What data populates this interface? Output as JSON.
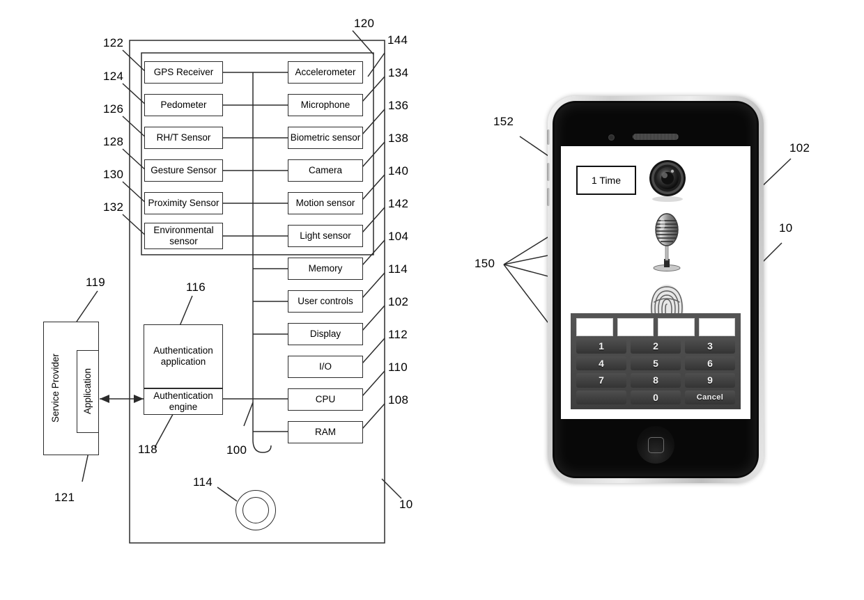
{
  "figure": {
    "left_block_diagram": {
      "device_ref": "10",
      "bus_ref": "100",
      "sensor_group_ref": "120",
      "sensor_group_outer_ref": "144",
      "home_button_ref": "114",
      "sensors_left": [
        {
          "label": "GPS Receiver",
          "ref": "122"
        },
        {
          "label": "Pedometer",
          "ref": "124"
        },
        {
          "label": "RH/T Sensor",
          "ref": "126"
        },
        {
          "label": "Gesture Sensor",
          "ref": "128"
        },
        {
          "label": "Proximity Sensor",
          "ref": "130"
        },
        {
          "label": "Environmental sensor",
          "ref": "132"
        }
      ],
      "sensors_right": [
        {
          "label": "Accelerometer",
          "ref": "134"
        },
        {
          "label": "Microphone",
          "ref": "136"
        },
        {
          "label": "Biometric sensor",
          "ref": "138"
        },
        {
          "label": "Camera",
          "ref": "140"
        },
        {
          "label": "Motion sensor",
          "ref": "142"
        },
        {
          "label": "Light sensor",
          "ref": "104"
        }
      ],
      "components": [
        {
          "label": "Memory",
          "ref": "114"
        },
        {
          "label": "User controls",
          "ref": "102"
        },
        {
          "label": "Display",
          "ref": "112"
        },
        {
          "label": "I/O",
          "ref": "110"
        },
        {
          "label": "CPU",
          "ref": "108"
        },
        {
          "label": "RAM",
          "ref": ""
        }
      ],
      "service_provider": {
        "label": "Service Provider",
        "ref": "119",
        "application_label": "Application",
        "application_ref": "121"
      },
      "authentication": {
        "application_label": "Authentication application",
        "application_ref": "116",
        "engine_label": "Authentication engine",
        "engine_ref": "118"
      }
    },
    "right_phone": {
      "device_ref": "10",
      "display_ref": "102",
      "icons_ref": "150",
      "count_badge_ref": "152",
      "count_badge_label": "1 Time",
      "icons": [
        {
          "name": "camera-icon"
        },
        {
          "name": "microphone-icon"
        },
        {
          "name": "fingerprint-icon"
        }
      ],
      "keypad": {
        "pin_cells": [
          "",
          "",
          "",
          ""
        ],
        "rows": [
          [
            "1",
            "2",
            "3"
          ],
          [
            "4",
            "5",
            "6"
          ],
          [
            "7",
            "8",
            "9"
          ],
          [
            "",
            "0",
            "Cancel"
          ]
        ]
      }
    }
  }
}
